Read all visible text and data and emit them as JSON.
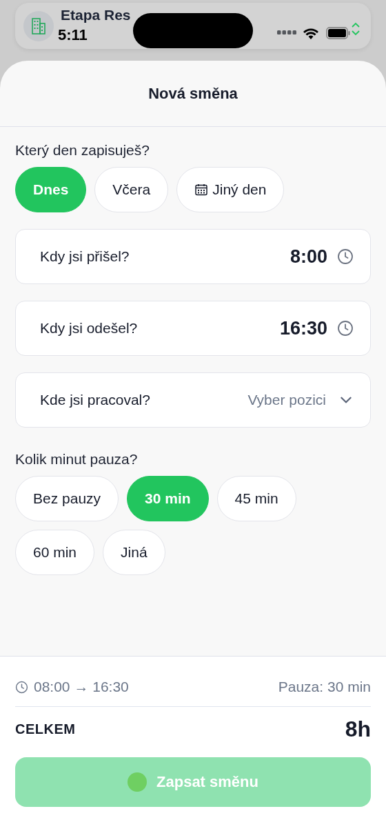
{
  "status_bar": {
    "app_title": "Etapa Res",
    "time": "5:11"
  },
  "sheet": {
    "title": "Nová směna"
  },
  "day": {
    "label": "Který den zapisuješ?",
    "options": [
      {
        "label": "Dnes",
        "selected": true,
        "kind": "plain"
      },
      {
        "label": "Včera",
        "selected": false,
        "kind": "plain"
      },
      {
        "label": "Jiný den",
        "selected": false,
        "kind": "calendar"
      }
    ]
  },
  "fields": [
    {
      "kind": "time",
      "label": "Kdy jsi přišel?",
      "value": "8:00"
    },
    {
      "kind": "time",
      "label": "Kdy jsi odešel?",
      "value": "16:30"
    },
    {
      "kind": "select",
      "label": "Kde jsi pracoval?",
      "placeholder": "Vyber pozici"
    }
  ],
  "pause": {
    "label": "Kolik minut pauza?",
    "options": [
      {
        "label": "Bez pauzy",
        "selected": false
      },
      {
        "label": "30 min",
        "selected": true
      },
      {
        "label": "45 min",
        "selected": false
      },
      {
        "label": "60 min",
        "selected": false
      },
      {
        "label": "Jiná",
        "selected": false
      }
    ]
  },
  "summary": {
    "range": "08:00 → 16:30",
    "pause": "Pauza: 30 min",
    "total_label": "CELKEM",
    "total": "8h"
  },
  "submit": {
    "label": "Zapsat směnu",
    "disabled": true
  }
}
